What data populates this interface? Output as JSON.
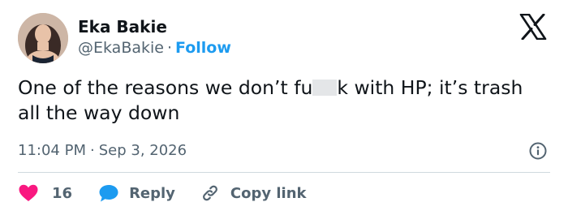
{
  "author": {
    "name": "Eka Bakie",
    "handle": "@EkaBakie",
    "separator": "·",
    "follow_label": "Follow"
  },
  "tweet": {
    "text_before": "One of the reasons we don’t fu",
    "text_after": "k with HP; it’s trash all the way down",
    "time": "11:04 PM",
    "separator": "·",
    "date": "Sep 3, 2026"
  },
  "actions": {
    "like_count": "16",
    "reply_label": "Reply",
    "copy_link_label": "Copy link"
  },
  "icons": {
    "brand": "x-logo-icon",
    "info": "info-icon",
    "like": "heart-icon",
    "reply": "speech-bubble-icon",
    "copy_link": "link-icon"
  },
  "colors": {
    "text": "#0f1419",
    "secondary": "#536471",
    "accent": "#1d9bf0",
    "like": "#f91880",
    "divider": "#cfd9de"
  }
}
